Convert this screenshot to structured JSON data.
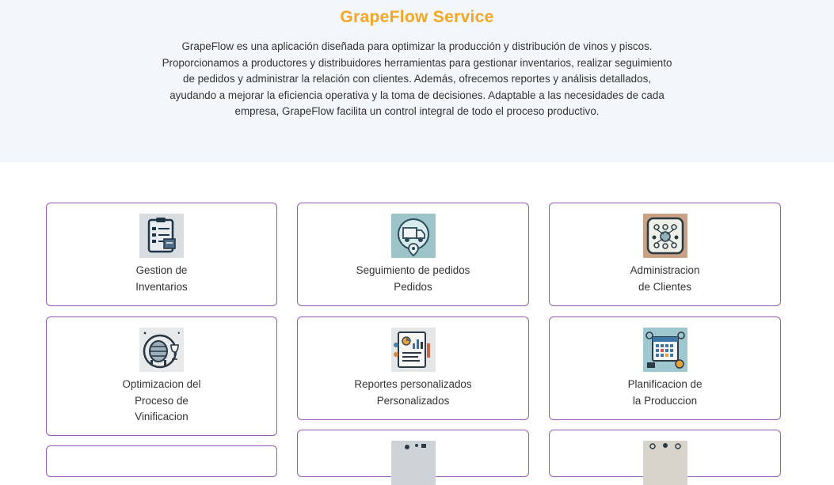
{
  "hero": {
    "title": "GrapeFlow Service",
    "description": "GrapeFlow es una aplicación diseñada para optimizar la producción y distribución de vinos y piscos. Proporcionamos a productores y distribuidores herramientas para gestionar inventarios, realizar seguimiento de pedidos y administrar la relación con clientes. Además, ofrecemos reportes y análisis detallados, ayudando a mejorar la eficiencia operativa y la toma de decisiones. Adaptable a las necesidades de cada empresa, GrapeFlow facilita un control integral de todo el proceso productivo."
  },
  "services": [
    {
      "icon": "inventory-clipboard-icon",
      "lines": [
        "Gestion de",
        "Inventarios"
      ]
    },
    {
      "icon": "delivery-truck-icon",
      "lines": [
        "Seguimiento de pedidos",
        "Pedidos"
      ]
    },
    {
      "icon": "client-network-icon",
      "lines": [
        "Administracion",
        "de Clientes"
      ]
    },
    {
      "icon": "wine-barrel-icon",
      "lines": [
        "Optimizacion del",
        "Proceso de",
        "Vinificacion"
      ]
    },
    {
      "icon": "report-dashboard-icon",
      "lines": [
        "Reportes personalizados",
        "Personalizados"
      ]
    },
    {
      "icon": "production-calendar-icon",
      "lines": [
        "Planificacion de",
        "la Produccion"
      ]
    }
  ],
  "colors": {
    "accent": "#f5a623",
    "card_border": "#9b59b6",
    "hero_bg": "#f3f6fa"
  }
}
